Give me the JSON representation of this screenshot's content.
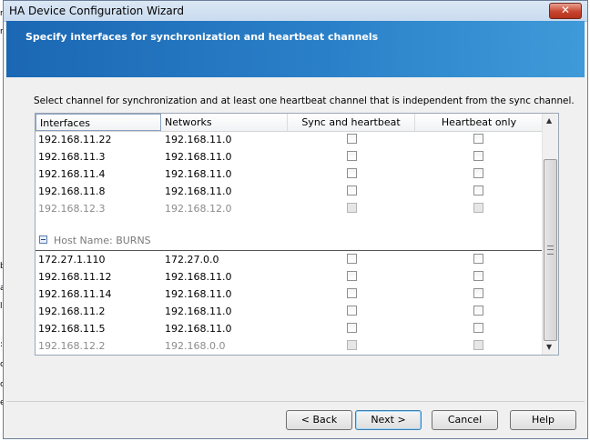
{
  "window": {
    "title": "HA Device Configuration Wizard",
    "close_label": "✕"
  },
  "header": {
    "title": "Specify interfaces for synchronization and heartbeat channels"
  },
  "instruction": "Select channel for synchronization and at least one heartbeat channel that is independent from the sync channel.",
  "grid": {
    "columns": [
      "Interfaces",
      "Networks",
      "Sync and heartbeat",
      "Heartbeat only"
    ],
    "rows_a": [
      {
        "interface": "192.168.11.22",
        "network": "192.168.11.0",
        "sync": false,
        "heartbeat": false,
        "disabled": false
      },
      {
        "interface": "192.168.11.3",
        "network": "192.168.11.0",
        "sync": false,
        "heartbeat": false,
        "disabled": false
      },
      {
        "interface": "192.168.11.4",
        "network": "192.168.11.0",
        "sync": false,
        "heartbeat": false,
        "disabled": false
      },
      {
        "interface": "192.168.11.8",
        "network": "192.168.11.0",
        "sync": false,
        "heartbeat": false,
        "disabled": false
      },
      {
        "interface": "192.168.12.3",
        "network": "192.168.12.0",
        "sync": false,
        "heartbeat": false,
        "disabled": true
      }
    ],
    "group_label": "Host Name: BURNS",
    "rows_b": [
      {
        "interface": "172.27.1.110",
        "network": "172.27.0.0",
        "sync": false,
        "heartbeat": false,
        "disabled": false
      },
      {
        "interface": "192.168.11.12",
        "network": "192.168.11.0",
        "sync": false,
        "heartbeat": false,
        "disabled": false
      },
      {
        "interface": "192.168.11.14",
        "network": "192.168.11.0",
        "sync": false,
        "heartbeat": false,
        "disabled": false
      },
      {
        "interface": "192.168.11.2",
        "network": "192.168.11.0",
        "sync": false,
        "heartbeat": false,
        "disabled": false
      },
      {
        "interface": "192.168.11.5",
        "network": "192.168.11.0",
        "sync": false,
        "heartbeat": false,
        "disabled": false
      },
      {
        "interface": "192.168.12.2",
        "network": "192.168.0.0",
        "sync": false,
        "heartbeat": false,
        "disabled": true
      }
    ]
  },
  "buttons": {
    "back": "< Back",
    "next": "Next >",
    "cancel": "Cancel",
    "help": "Help"
  },
  "background_chars": [
    "r",
    "r",
    "b",
    "a",
    "l",
    ":",
    "c",
    "c",
    "e"
  ]
}
